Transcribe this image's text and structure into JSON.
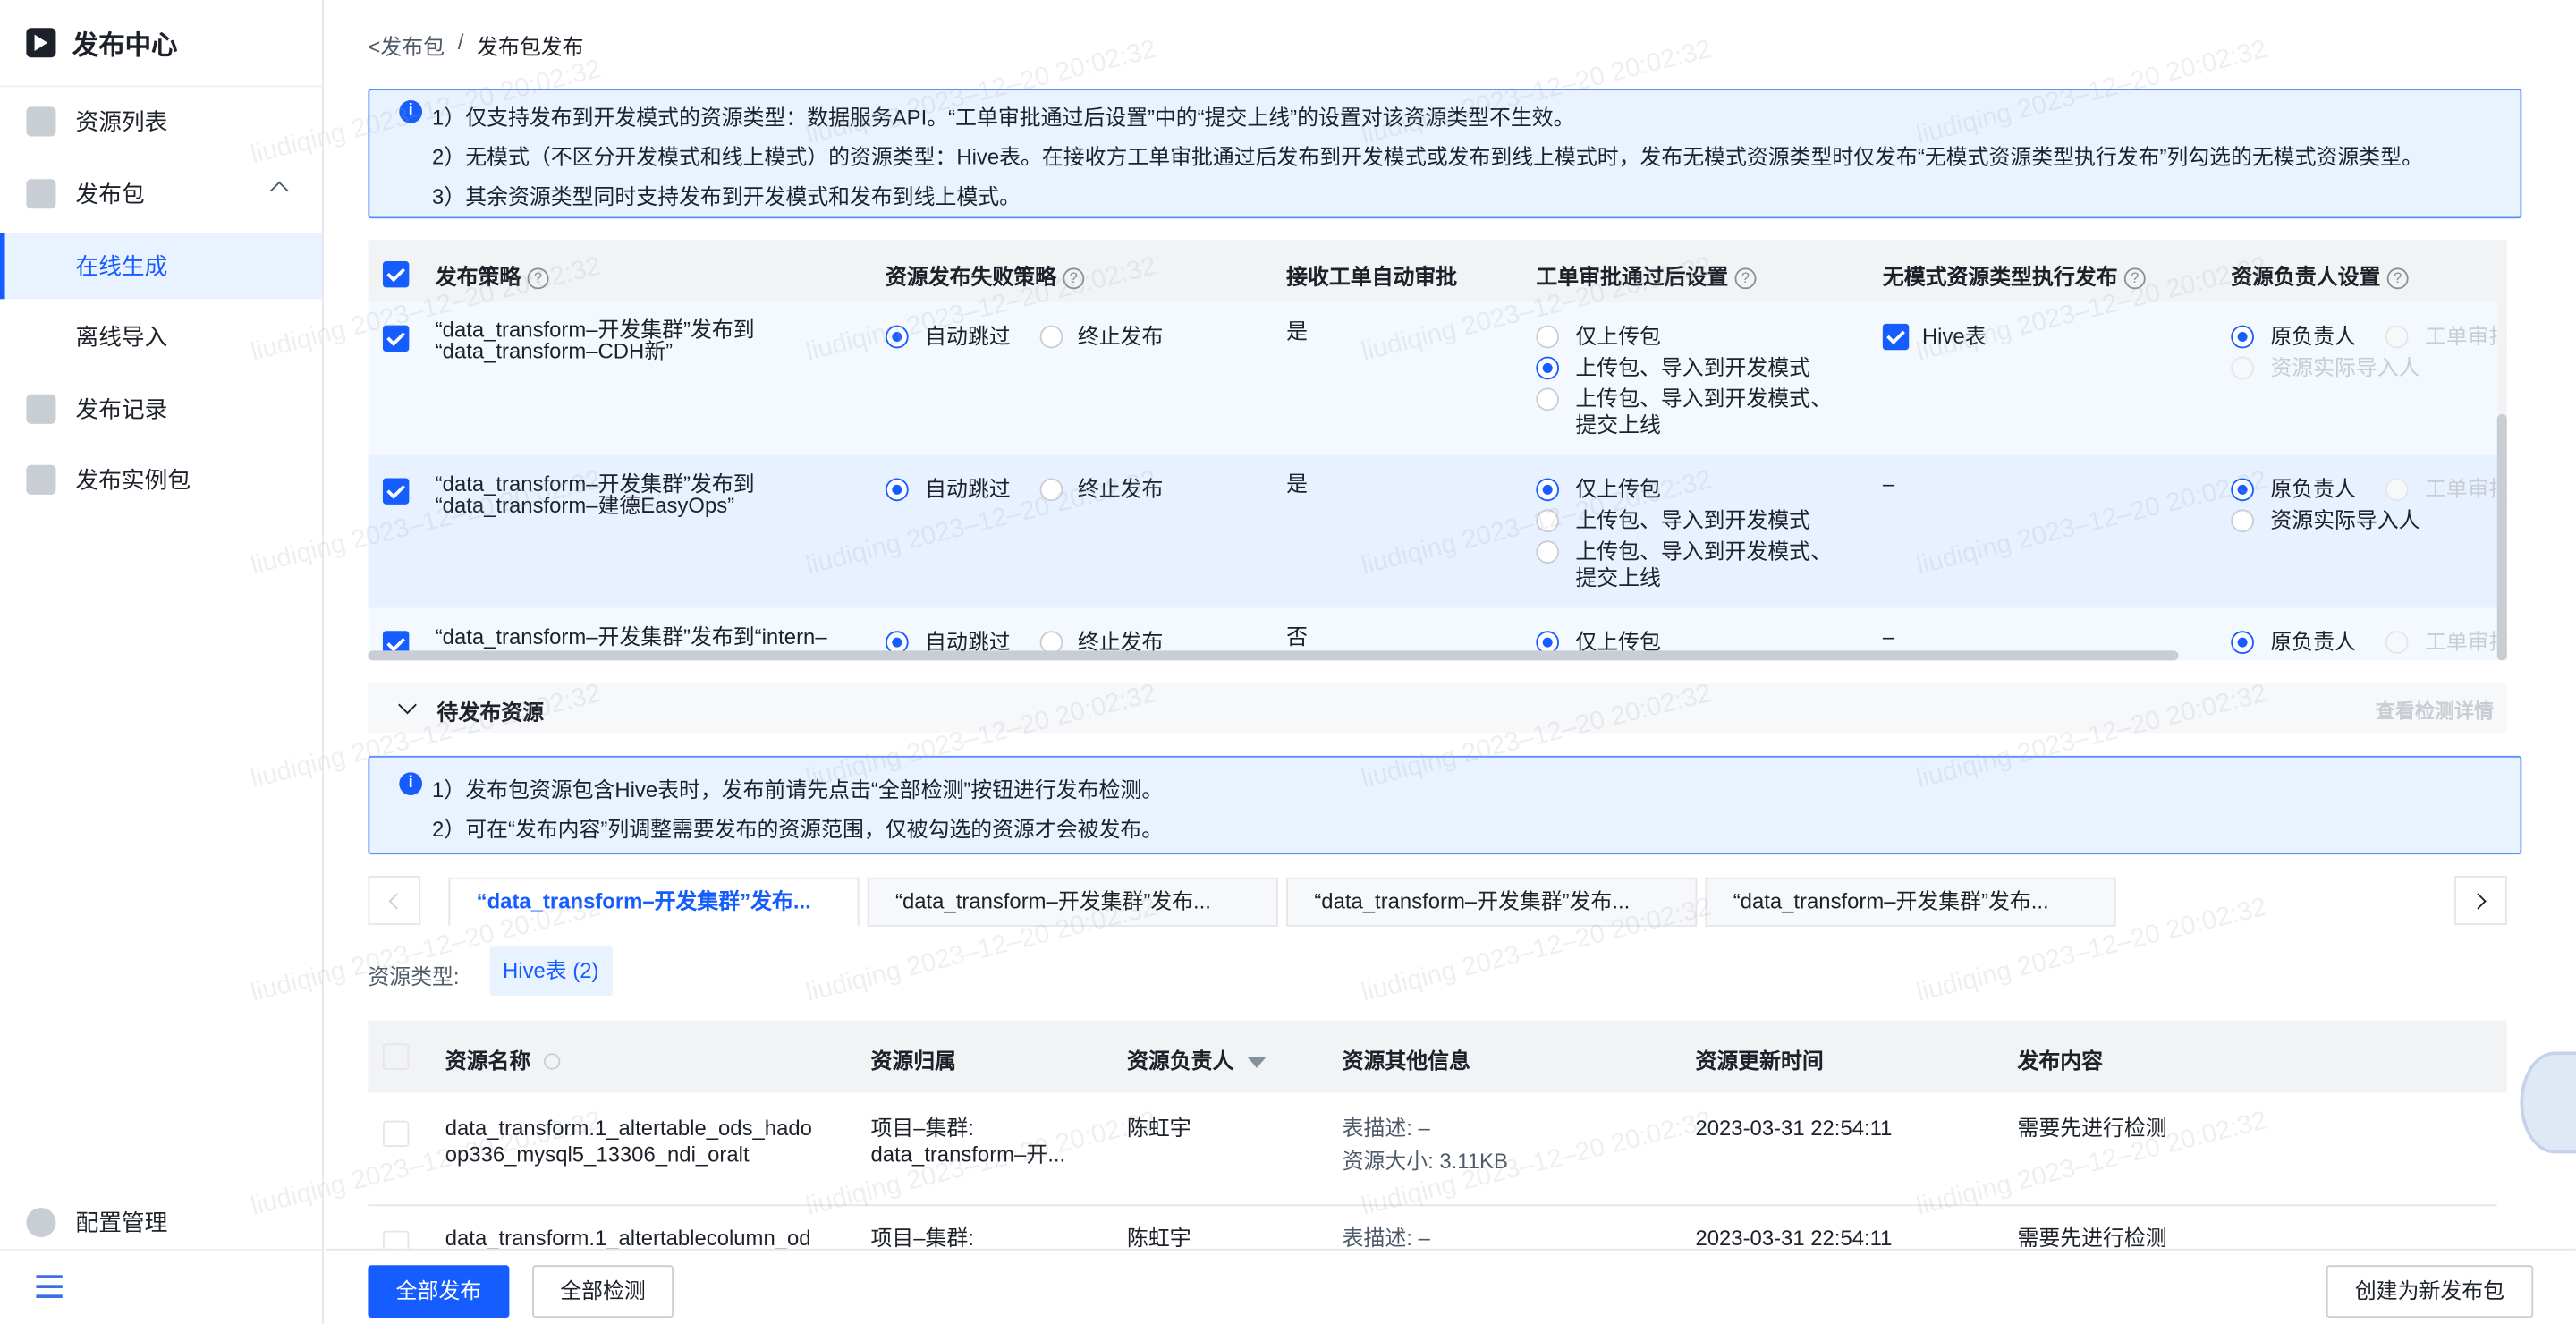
{
  "sidebar": {
    "title": "发布中心",
    "items": [
      {
        "label": "资源列表",
        "icon": "list-icon"
      },
      {
        "label": "发布包",
        "icon": "package-icon"
      },
      {
        "label": "在线生成"
      },
      {
        "label": "离线导入"
      },
      {
        "label": "发布记录",
        "icon": "cloud-upload-icon"
      },
      {
        "label": "发布实例包",
        "icon": "instance-package-icon"
      }
    ],
    "config": "配置管理"
  },
  "breadcrumb": {
    "back": "发布包",
    "sep": "/",
    "current": "发布包发布"
  },
  "alert1": {
    "lines": [
      "1）仅支持发布到开发模式的资源类型：数据服务API。“工单审批通过后设置”中的“提交上线”的设置对该资源类型不生效。",
      "2）无模式（不区分开发模式和线上模式）的资源类型：Hive表。在接收方工单审批通过后发布到开发模式或发布到线上模式时，发布无模式资源类型时仅发布“无模式资源类型执行发布”列勾选的无模式资源类型。",
      "3）其余资源类型同时支持发布到开发模式和发布到线上模式。"
    ]
  },
  "strategy_table": {
    "headers": [
      "发布策略",
      "资源发布失败策略",
      "接收工单自动审批",
      "工单审批通过后设置",
      "无模式资源类型执行发布",
      "资源负责人设置"
    ],
    "opts": {
      "skip": "自动跳过",
      "stop": "终止发布",
      "upload": "仅上传包",
      "upload_dev": "上传包、导入到开发模式",
      "upload_online_a": "上传包、导入到开发模式、",
      "upload_online_b": "提交上线",
      "hive": "Hive表",
      "owner": "原负责人",
      "ticket": "工单审批",
      "actual": "资源实际导入人"
    },
    "rows": [
      {
        "name_a": "“data_transform–开发集群”发布到",
        "name_b": "“data_transform–CDH新”",
        "auto": "是",
        "nomode": ""
      },
      {
        "name_a": "“data_transform–开发集群”发布到",
        "name_b": "“data_transform–建德EasyOps”",
        "auto": "是",
        "nomode": "–"
      },
      {
        "name_a": "“data_transform–开发集群”发布到“intern–",
        "name_b": "",
        "auto": "否",
        "nomode": "–"
      }
    ]
  },
  "pending": {
    "title": "待发布资源",
    "detail_link": "查看检测详情"
  },
  "alert2": {
    "lines": [
      "1）发布包资源包含Hive表时，发布前请先点击“全部检测”按钮进行发布检测。",
      "2）可在“发布内容”列调整需要发布的资源范围，仅被勾选的资源才会被发布。"
    ]
  },
  "tabs": [
    "“data_transform–开发集群”发布...",
    "“data_transform–开发集群”发布...",
    "“data_transform–开发集群”发布...",
    "“data_transform–开发集群”发布..."
  ],
  "resource_type": {
    "label": "资源类型:",
    "chip": "Hive表 (2)"
  },
  "res_table": {
    "headers": [
      "资源名称",
      "资源归属",
      "资源负责人",
      "资源其他信息",
      "资源更新时间",
      "发布内容"
    ],
    "rows": [
      {
        "name_a": "data_transform.1_altertable_ods_hado",
        "name_b": "op336_mysql5_13306_ndi_oralt",
        "owner_a": "项目–集群:",
        "owner_b": "data_transform–开...",
        "person": "陈虹宇",
        "info_a": "表描述: –",
        "info_b": "资源大小: 3.11KB",
        "time": "2023-03-31 22:54:11",
        "content": "需要先进行检测"
      },
      {
        "name_a": "data_transform.1_altertablecolumn_od",
        "name_b": "",
        "owner_a": "项目–集群:",
        "owner_b": "",
        "person": "陈虹宇",
        "info_a": "表描述: –",
        "info_b": "",
        "time": "2023-03-31 22:54:11",
        "content": "需要先进行检测"
      }
    ]
  },
  "footer": {
    "publish_all": "全部发布",
    "check_all": "全部检测",
    "create_new": "创建为新发布包"
  },
  "watermark": "liudiqing 2023–12–20 20:02:32",
  "colors": {
    "primary": "#165dff",
    "alert_bg": "#e8f3ff"
  }
}
